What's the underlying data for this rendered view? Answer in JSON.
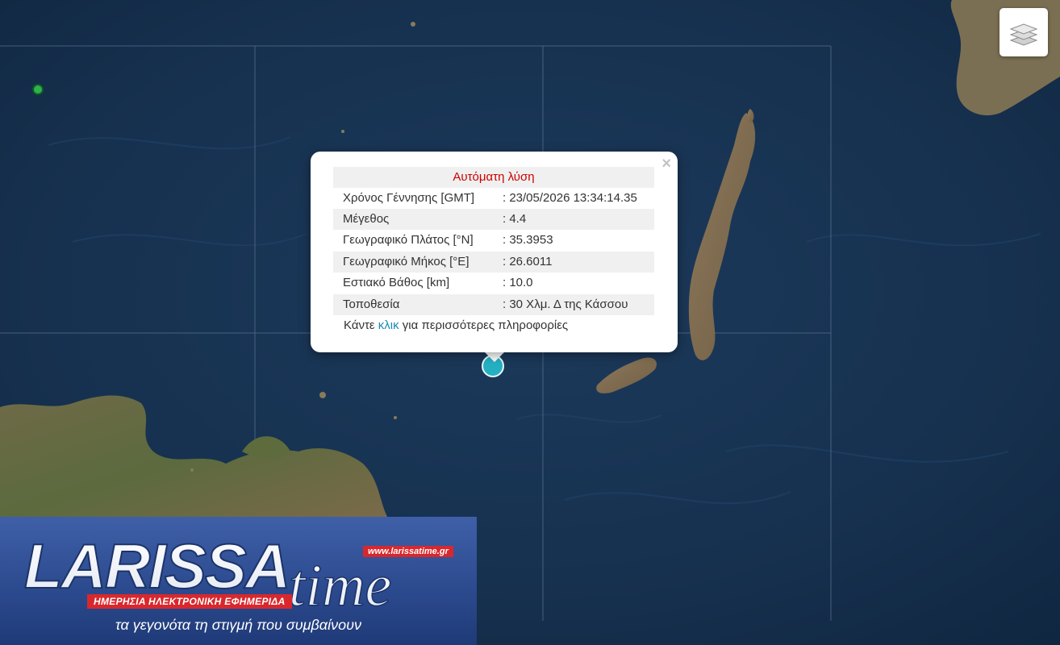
{
  "popup": {
    "title": "Αυτόματη λύση",
    "close_glyph": "×",
    "rows": [
      {
        "label": "Χρόνος Γέννησης [GMT]",
        "value": ": 23/05/2026 13:34:14.35"
      },
      {
        "label": "Μέγεθος",
        "value": ": 4.4"
      },
      {
        "label": "Γεωγραφικό Πλάτος [°N]",
        "value": ": 35.3953"
      },
      {
        "label": "Γεωγραφικό Μήκος [°E]",
        "value": ": 26.6011"
      },
      {
        "label": "Εστιακό Βάθος [km]",
        "value": ": 10.0"
      },
      {
        "label": "Τοποθεσία",
        "value": ": 30 Χλμ. Δ της Κάσσου"
      }
    ],
    "more_prefix": "Κάντε ",
    "more_link": "κλικ",
    "more_suffix": " για περισσότερες πληροφορίες"
  },
  "map": {
    "layers_control_icon": "layers-icon",
    "earthquake_marker_color": "#25b0c2",
    "other_marker_color": "#2fb24a"
  },
  "banner": {
    "logo_word_1": "LARISSA",
    "logo_word_2": "time",
    "url": "www.larissatime.gr",
    "tagline": "ΗΜΕΡΗΣΙΑ ΗΛΕΚΤΡΟΝΙΚΗ ΕΦΗΜΕΡΙΔΑ",
    "slogan": "τα γεγονότα τη στιγμή που συμβαίνουν"
  }
}
